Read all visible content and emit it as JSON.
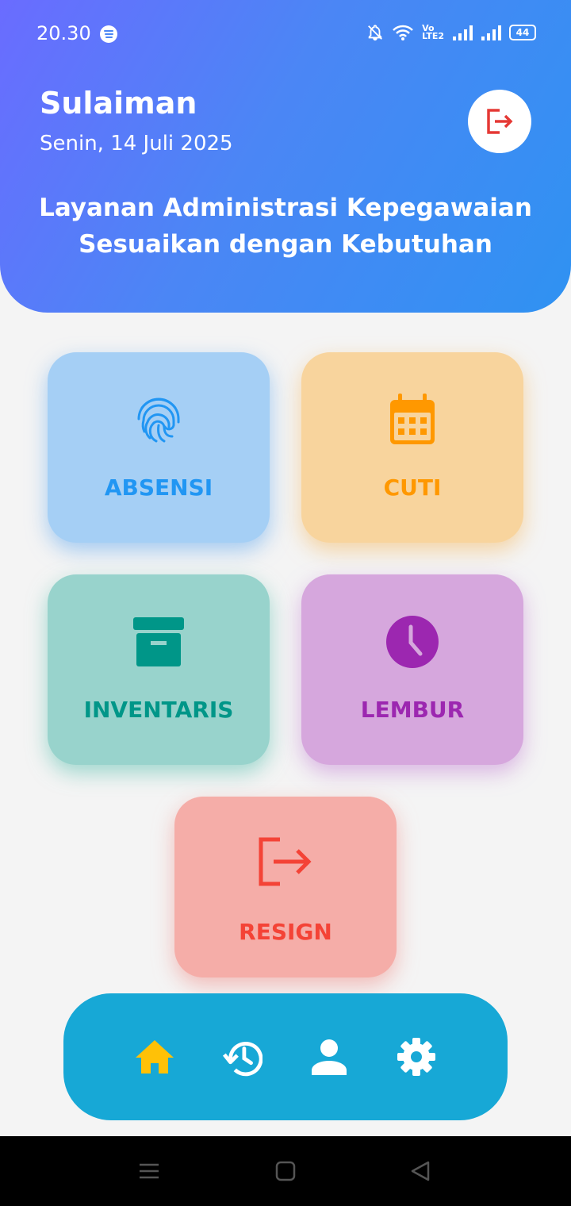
{
  "status_bar": {
    "time": "20.30",
    "battery": "44",
    "volte_top": "Vo",
    "volte_bottom": "LTE2",
    "icons": [
      "spotify-icon",
      "bell-off-icon",
      "wifi-icon",
      "volte-icon",
      "signal-icon",
      "signal-icon",
      "battery-icon"
    ]
  },
  "header": {
    "user_name": "Sulaiman",
    "date": "Senin, 14 Juli 2025",
    "tagline_line1": "Layanan Administrasi Kepegawaian",
    "tagline_line2": "Sesuaikan dengan Kebutuhan",
    "logout_icon": "logout-icon"
  },
  "menu": {
    "absensi": {
      "label": "ABSENSI",
      "icon": "fingerprint-icon",
      "color": "#2196f3"
    },
    "cuti": {
      "label": "CUTI",
      "icon": "calendar-icon",
      "color": "#ff9800"
    },
    "inventaris": {
      "label": "INVENTARIS",
      "icon": "archive-box-icon",
      "color": "#009688"
    },
    "lembur": {
      "label": "LEMBUR",
      "icon": "clock-icon",
      "color": "#9c27b0"
    },
    "resign": {
      "label": "RESIGN",
      "icon": "exit-icon",
      "color": "#f44336"
    }
  },
  "bottom_nav": {
    "items": [
      "home-icon",
      "history-icon",
      "profile-icon",
      "settings-icon"
    ],
    "active": "home-icon",
    "active_color": "#ffc107",
    "background": "#17a8d6"
  },
  "system_nav": [
    "menu-icon",
    "home-square-icon",
    "back-icon"
  ]
}
